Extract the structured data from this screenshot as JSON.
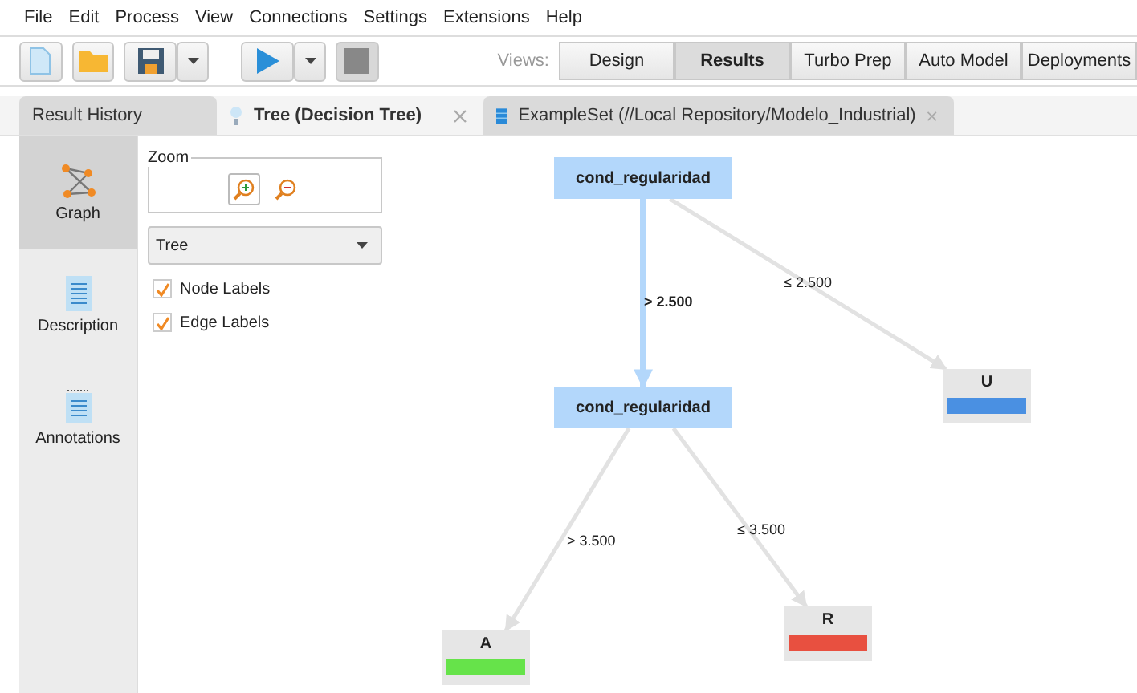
{
  "menu": [
    "File",
    "Edit",
    "Process",
    "View",
    "Connections",
    "Settings",
    "Extensions",
    "Help"
  ],
  "views": {
    "label": "Views:",
    "items": [
      {
        "label": "Design",
        "selected": false
      },
      {
        "label": "Results",
        "selected": true
      },
      {
        "label": "Turbo Prep",
        "selected": false
      },
      {
        "label": "Auto Model",
        "selected": false
      },
      {
        "label": "Deployments",
        "selected": false
      }
    ]
  },
  "tabs": [
    {
      "label": "Result History",
      "kind": "plain",
      "selected": false,
      "closable": false
    },
    {
      "label": "Tree (Decision Tree)",
      "kind": "tree",
      "selected": true,
      "closable": true
    },
    {
      "label": "ExampleSet (//Local Repository/Modelo_Industrial)",
      "kind": "data",
      "selected": false,
      "closable": true
    }
  ],
  "sidebar": {
    "items": [
      {
        "label": "Graph",
        "kind": "graph",
        "selected": true
      },
      {
        "label": "Description",
        "kind": "description",
        "selected": false
      },
      {
        "label": "Annotations",
        "kind": "annotations",
        "selected": false
      }
    ]
  },
  "controls": {
    "zoom_label": "Zoom",
    "layout": "Tree",
    "checkboxes": [
      {
        "label": "Node Labels",
        "checked": true
      },
      {
        "label": "Edge Labels",
        "checked": true
      }
    ]
  },
  "tree": {
    "label": "cond_regularidad",
    "kind": "split",
    "children": [
      {
        "edge": "> 2.500",
        "highlighted": true,
        "label": "cond_regularidad",
        "kind": "split",
        "children": [
          {
            "edge": "> 3.500",
            "highlighted": false,
            "label": "A",
            "kind": "leaf",
            "color": "#66e34a"
          },
          {
            "edge": "≤ 3.500",
            "highlighted": false,
            "label": "R",
            "kind": "leaf",
            "color": "#e85040"
          }
        ]
      },
      {
        "edge": "≤ 2.500",
        "highlighted": false,
        "label": "U",
        "kind": "leaf",
        "color": "#4a90e2"
      }
    ]
  }
}
